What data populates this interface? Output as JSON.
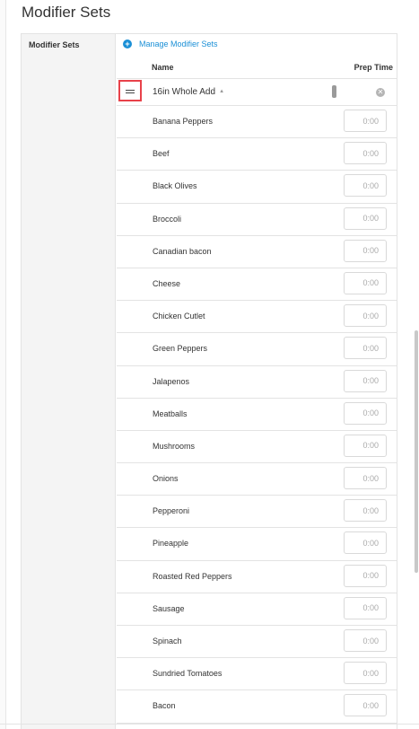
{
  "page": {
    "title": "Modifier Sets"
  },
  "section": {
    "label": "Modifier Sets",
    "manage_link": "Manage Modifier Sets",
    "manage_icon": "plus-circle-icon"
  },
  "table": {
    "col_name": "Name",
    "col_prep_time": "Prep Time"
  },
  "group": {
    "name": "16in Whole Add",
    "sort_icon": "caret-up-icon",
    "remove_icon": "close-circle-icon",
    "drag_icon": "drag-handle-icon"
  },
  "modifiers": [
    {
      "name": "Banana Peppers",
      "prep_time": "0:00"
    },
    {
      "name": "Beef",
      "prep_time": "0:00"
    },
    {
      "name": "Black Olives",
      "prep_time": "0:00"
    },
    {
      "name": "Broccoli",
      "prep_time": "0:00"
    },
    {
      "name": "Canadian bacon",
      "prep_time": "0:00"
    },
    {
      "name": "Cheese",
      "prep_time": "0:00"
    },
    {
      "name": "Chicken Cutlet",
      "prep_time": "0:00"
    },
    {
      "name": "Green Peppers",
      "prep_time": "0:00"
    },
    {
      "name": "Jalapenos",
      "prep_time": "0:00"
    },
    {
      "name": "Meatballs",
      "prep_time": "0:00"
    },
    {
      "name": "Mushrooms",
      "prep_time": "0:00"
    },
    {
      "name": "Onions",
      "prep_time": "0:00"
    },
    {
      "name": "Pepperoni",
      "prep_time": "0:00"
    },
    {
      "name": "Pineapple",
      "prep_time": "0:00"
    },
    {
      "name": "Roasted Red Peppers",
      "prep_time": "0:00"
    },
    {
      "name": "Sausage",
      "prep_time": "0:00"
    },
    {
      "name": "Spinach",
      "prep_time": "0:00"
    },
    {
      "name": "Sundried Tomatoes",
      "prep_time": "0:00"
    },
    {
      "name": "Bacon",
      "prep_time": "0:00"
    }
  ],
  "colors": {
    "link": "#1a8fd6",
    "highlight": "#e8424a",
    "border": "#e3e3e3"
  }
}
